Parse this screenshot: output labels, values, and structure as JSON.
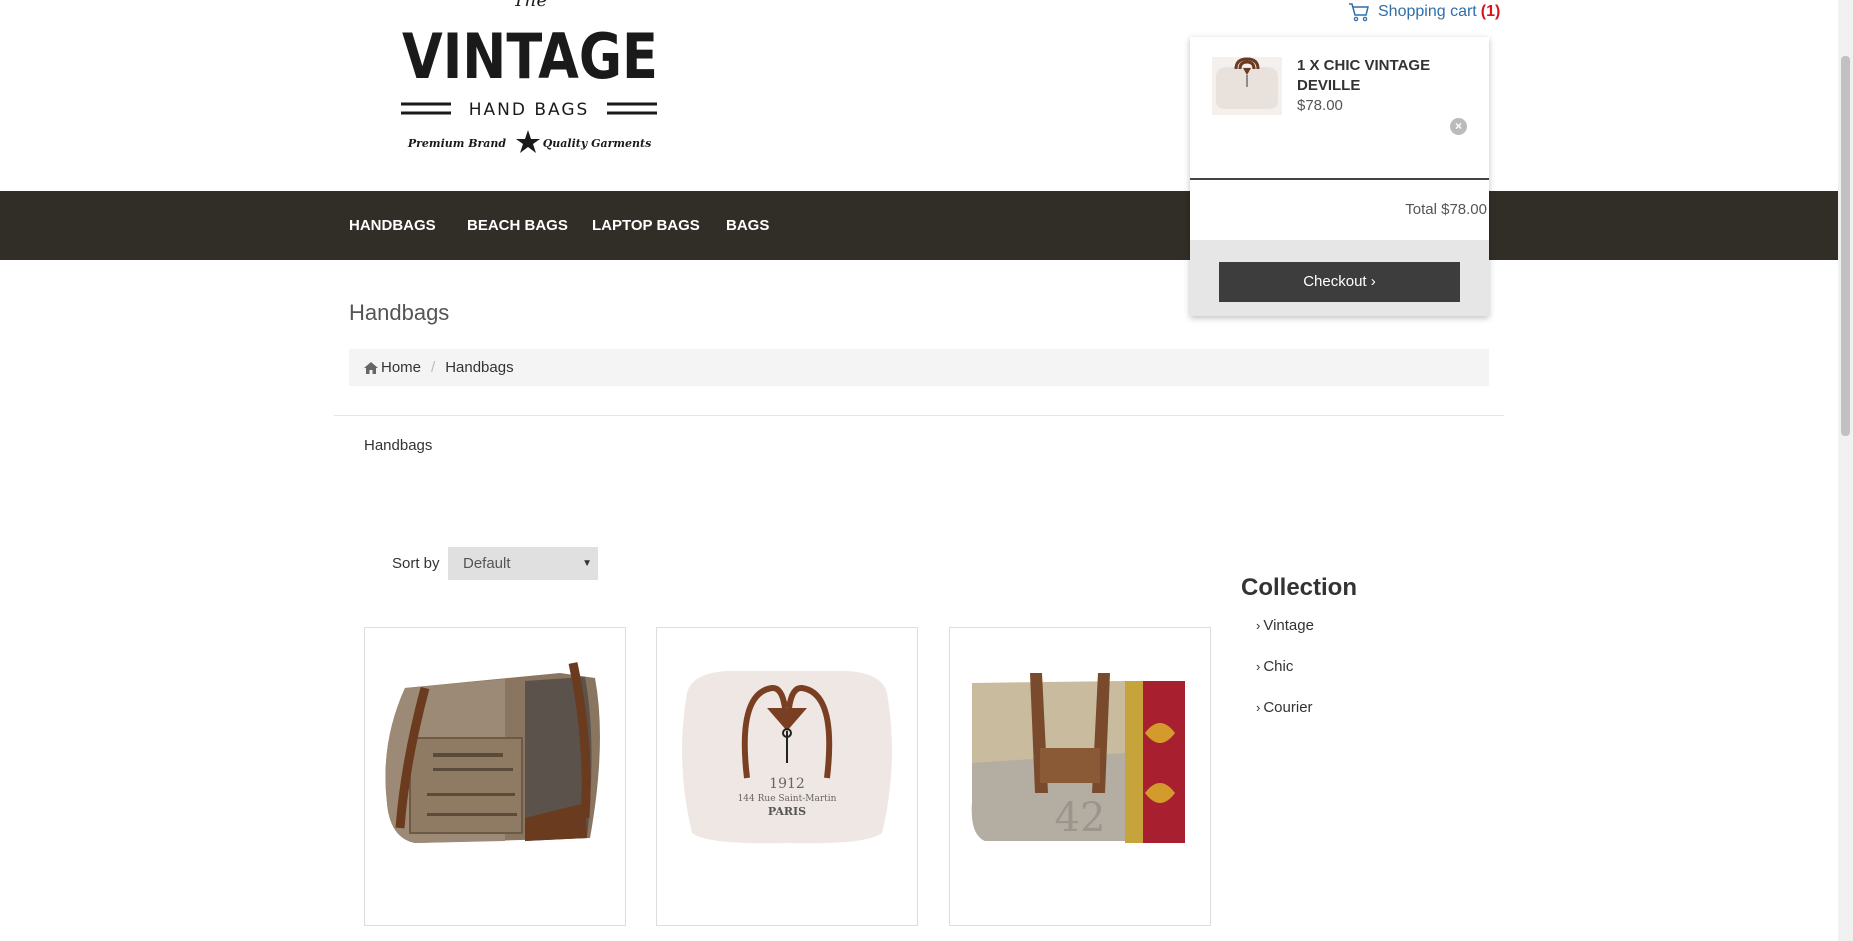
{
  "header": {
    "logo": {
      "top_word": "The",
      "main_word": "VINTAGE",
      "sub_word": "HAND BAGS",
      "tagline_left": "Premium Brand",
      "tagline_right": "Quality Garments"
    },
    "cart": {
      "label": "Shopping cart",
      "count": "(1)"
    }
  },
  "nav": {
    "items": [
      {
        "label": "HANDBAGS"
      },
      {
        "label": "BEACH BAGS"
      },
      {
        "label": "LAPTOP BAGS"
      },
      {
        "label": "BAGS"
      }
    ]
  },
  "cart_dropdown": {
    "item_name": "1 X CHIC VINTAGE DEVILLE",
    "item_price": "$78.00",
    "total": "Total $78.00",
    "checkout_label": "Checkout ›"
  },
  "page": {
    "title": "Handbags",
    "breadcrumb": {
      "home": "Home",
      "current": "Handbags"
    },
    "collection_label": "Handbags"
  },
  "sort": {
    "label": "Sort by",
    "selected": "Default"
  },
  "sidebar": {
    "title": "Collection",
    "links": [
      {
        "label": "Vintage"
      },
      {
        "label": "Chic"
      },
      {
        "label": "Courier"
      }
    ]
  },
  "colors": {
    "nav_bg": "#302e26",
    "link_blue": "#2f6fa7",
    "cart_count_red": "#d9141d",
    "checkout_bg": "#3d3d3d"
  }
}
